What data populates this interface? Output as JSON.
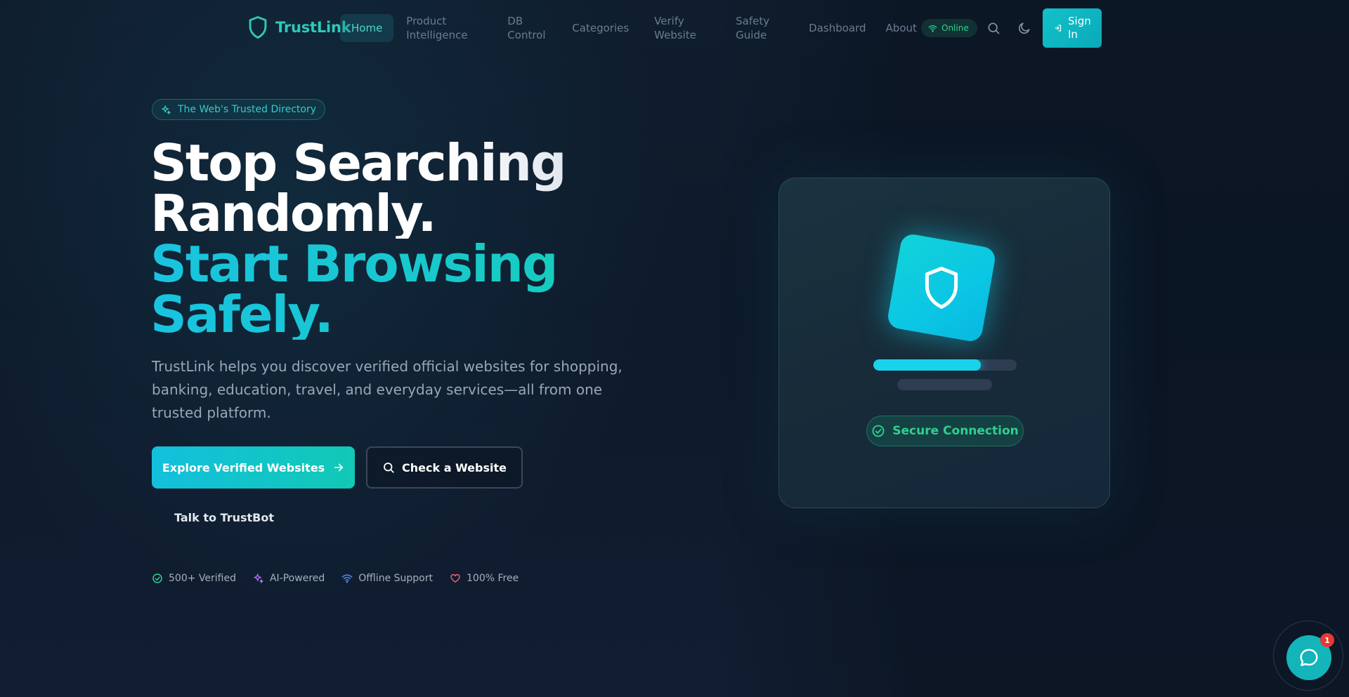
{
  "brand": {
    "name": "TrustLink",
    "logo_icon": "shield-icon"
  },
  "nav": {
    "items": [
      {
        "label": "Home",
        "active": true
      },
      {
        "label": "Product Intelligence"
      },
      {
        "label": "DB Control"
      },
      {
        "label": "Categories"
      },
      {
        "label": "Verify Website"
      },
      {
        "label": "Safety Guide"
      },
      {
        "label": "Dashboard"
      },
      {
        "label": "About"
      }
    ],
    "status": {
      "label": "Online",
      "icon": "wifi-icon"
    },
    "search_icon": "search-icon",
    "theme_icon": "moon-icon",
    "signin_label": "Sign In",
    "signin_icon": "login-icon"
  },
  "hero": {
    "badge": "The Web's Trusted Directory",
    "badge_icon": "sparkles-icon",
    "headline_line1": "Stop Searching Randomly.",
    "headline_line2": "Start Browsing Safely.",
    "subtext": "TrustLink helps you discover verified official websites for shopping, banking, education, travel, and everyday services—all from one trusted platform.",
    "primary_button": "Explore Verified Websites",
    "secondary_button": "Check a Website",
    "text_button": "Talk to TrustBot",
    "features": [
      {
        "label": "500+ Verified",
        "icon": "check-circle-icon",
        "color": "#2fd08f"
      },
      {
        "label": "AI-Powered",
        "icon": "sparkles-icon",
        "color": "#b36cf5"
      },
      {
        "label": "Offline Support",
        "icon": "wifi-icon",
        "color": "#4f8df5"
      },
      {
        "label": "100% Free",
        "icon": "heart-icon",
        "color": "#f0607a"
      }
    ]
  },
  "card": {
    "icon": "shield-icon",
    "progress": 0.75,
    "status": "Secure Connection",
    "status_icon": "check-circle-icon"
  },
  "chat": {
    "icon": "chat-icon",
    "badge_count": "1"
  },
  "colors": {
    "accent": "#14c4d2",
    "success": "#2fd08f",
    "background": "#0f1d2e"
  }
}
